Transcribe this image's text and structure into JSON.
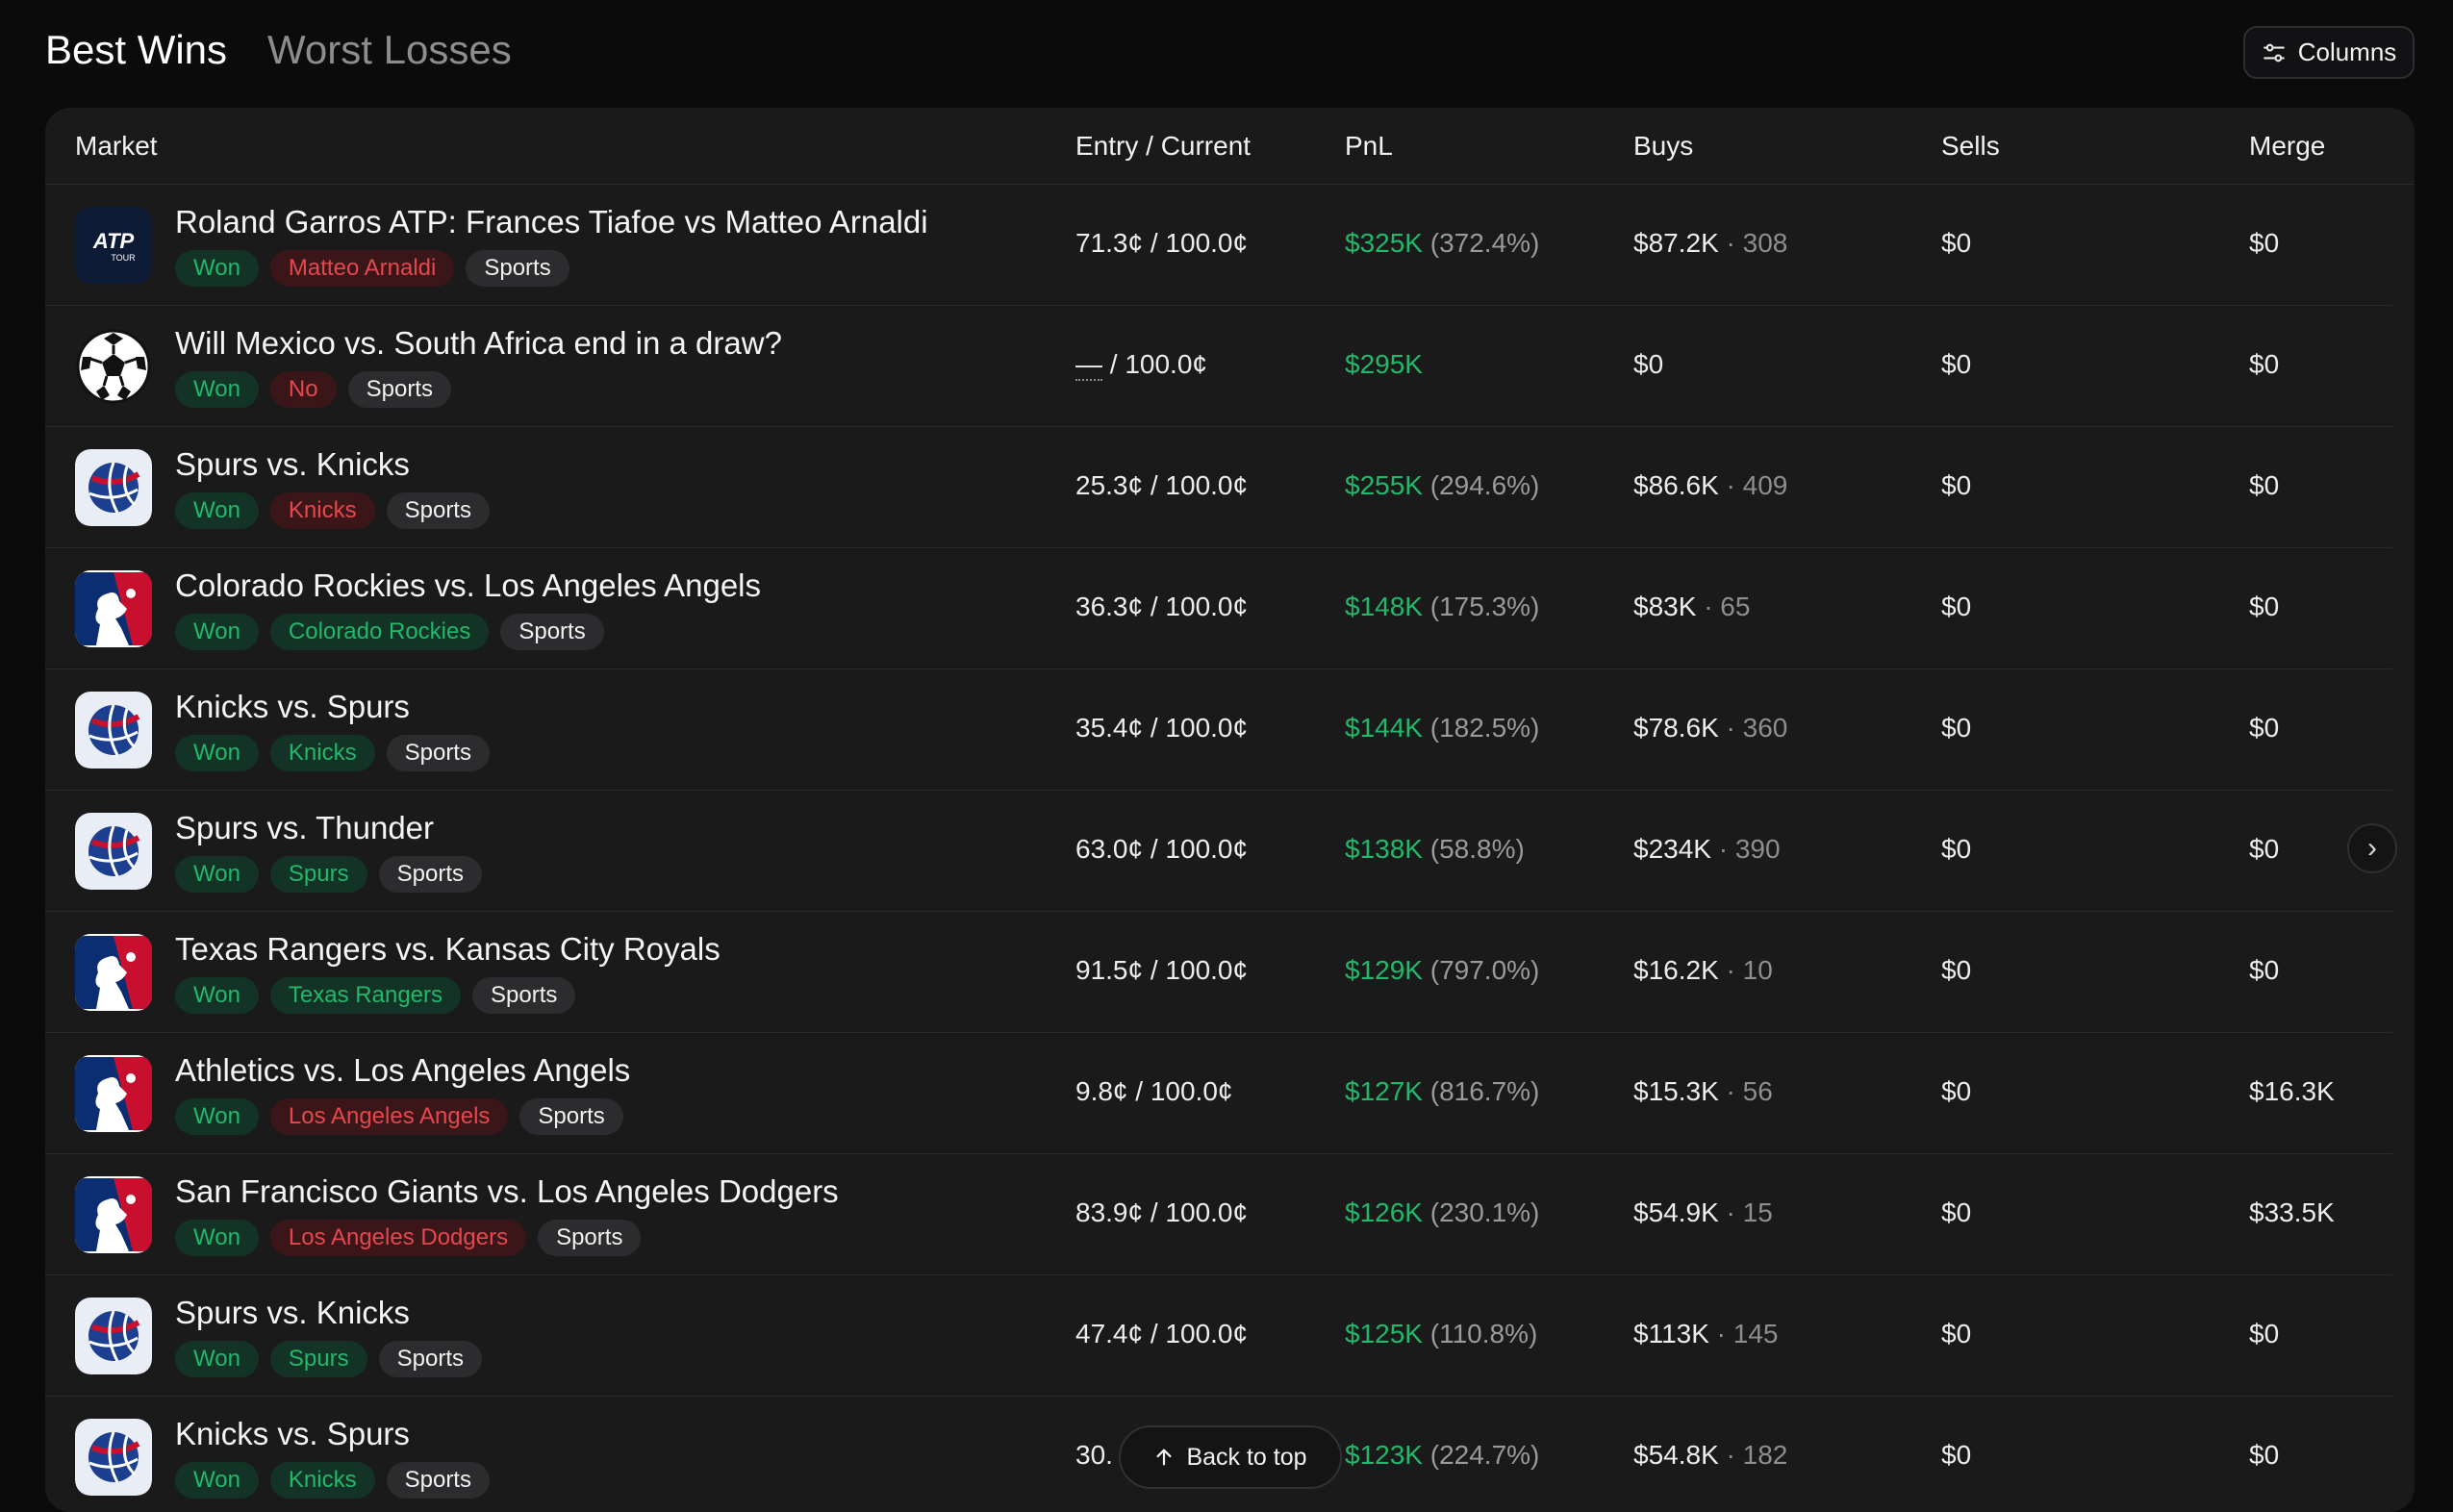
{
  "tabs": [
    {
      "label": "Best Wins",
      "active": true
    },
    {
      "label": "Worst Losses",
      "active": false
    }
  ],
  "columns_button": {
    "label": "Columns",
    "icon": "sliders-icon"
  },
  "headers": {
    "market": "Market",
    "entry": "Entry / Current",
    "pnl": "PnL",
    "buys": "Buys",
    "sells": "Sells",
    "merge": "Merge"
  },
  "rows": [
    {
      "logo": "atp-tour",
      "title": "Roland Garros ATP: Frances Tiafoe vs Matteo Arnaldi",
      "status": "Won",
      "outcome": "Matteo Arnaldi",
      "outcome_color": "red",
      "category": "Sports",
      "entry": "71.3¢",
      "current": "100.0¢",
      "pnl": "$325K",
      "pnl_pct": "(372.4%)",
      "buys": "$87.2K",
      "buys_count": "· 308",
      "sells": "$0",
      "merge": "$0"
    },
    {
      "logo": "soccer-ball",
      "title": "Will Mexico vs. South Africa end in a draw?",
      "status": "Won",
      "outcome": "No",
      "outcome_color": "red",
      "category": "Sports",
      "entry": "—",
      "current": "100.0¢",
      "pnl": "$295K",
      "pnl_pct": "",
      "buys": "$0",
      "buys_count": "",
      "sells": "$0",
      "merge": "$0"
    },
    {
      "logo": "nba-ball",
      "title": "Spurs vs. Knicks",
      "status": "Won",
      "outcome": "Knicks",
      "outcome_color": "red",
      "category": "Sports",
      "entry": "25.3¢",
      "current": "100.0¢",
      "pnl": "$255K",
      "pnl_pct": "(294.6%)",
      "buys": "$86.6K",
      "buys_count": "· 409",
      "sells": "$0",
      "merge": "$0"
    },
    {
      "logo": "mlb",
      "title": "Colorado Rockies vs. Los Angeles Angels",
      "status": "Won",
      "outcome": "Colorado Rockies",
      "outcome_color": "green",
      "category": "Sports",
      "entry": "36.3¢",
      "current": "100.0¢",
      "pnl": "$148K",
      "pnl_pct": "(175.3%)",
      "buys": "$83K",
      "buys_count": "· 65",
      "sells": "$0",
      "merge": "$0"
    },
    {
      "logo": "nba-ball",
      "title": "Knicks vs. Spurs",
      "status": "Won",
      "outcome": "Knicks",
      "outcome_color": "green",
      "category": "Sports",
      "entry": "35.4¢",
      "current": "100.0¢",
      "pnl": "$144K",
      "pnl_pct": "(182.5%)",
      "buys": "$78.6K",
      "buys_count": "· 360",
      "sells": "$0",
      "merge": "$0"
    },
    {
      "logo": "nba-ball",
      "title": "Spurs vs. Thunder",
      "status": "Won",
      "outcome": "Spurs",
      "outcome_color": "green",
      "category": "Sports",
      "entry": "63.0¢",
      "current": "100.0¢",
      "pnl": "$138K",
      "pnl_pct": "(58.8%)",
      "buys": "$234K",
      "buys_count": "· 390",
      "sells": "$0",
      "merge": "$0"
    },
    {
      "logo": "mlb",
      "title": "Texas Rangers vs. Kansas City Royals",
      "status": "Won",
      "outcome": "Texas Rangers",
      "outcome_color": "green",
      "category": "Sports",
      "entry": "91.5¢",
      "current": "100.0¢",
      "pnl": "$129K",
      "pnl_pct": "(797.0%)",
      "buys": "$16.2K",
      "buys_count": "· 10",
      "sells": "$0",
      "merge": "$0"
    },
    {
      "logo": "mlb",
      "title": "Athletics vs. Los Angeles Angels",
      "status": "Won",
      "outcome": "Los Angeles Angels",
      "outcome_color": "red",
      "category": "Sports",
      "entry": "9.8¢",
      "current": "100.0¢",
      "pnl": "$127K",
      "pnl_pct": "(816.7%)",
      "buys": "$15.3K",
      "buys_count": "· 56",
      "sells": "$0",
      "merge": "$16.3K"
    },
    {
      "logo": "mlb",
      "title": "San Francisco Giants vs. Los Angeles Dodgers",
      "status": "Won",
      "outcome": "Los Angeles Dodgers",
      "outcome_color": "red",
      "category": "Sports",
      "entry": "83.9¢",
      "current": "100.0¢",
      "pnl": "$126K",
      "pnl_pct": "(230.1%)",
      "buys": "$54.9K",
      "buys_count": "· 15",
      "sells": "$0",
      "merge": "$33.5K"
    },
    {
      "logo": "nba-ball",
      "title": "Spurs vs. Knicks",
      "status": "Won",
      "outcome": "Spurs",
      "outcome_color": "green",
      "category": "Sports",
      "entry": "47.4¢",
      "current": "100.0¢",
      "pnl": "$125K",
      "pnl_pct": "(110.8%)",
      "buys": "$113K",
      "buys_count": "· 145",
      "sells": "$0",
      "merge": "$0"
    },
    {
      "logo": "nba-ball",
      "title": "Knicks vs. Spurs",
      "status": "Won",
      "outcome": "Knicks",
      "outcome_color": "green",
      "category": "Sports",
      "entry": "30.",
      "current": "100.0¢",
      "pnl": "$123K",
      "pnl_pct": "(224.7%)",
      "buys": "$54.8K",
      "buys_count": "· 182",
      "sells": "$0",
      "merge": "$0"
    }
  ],
  "scroll_button": {
    "icon": "chevron-right-icon"
  },
  "back_to_top": {
    "label": "Back to top",
    "icon": "arrow-up-icon"
  }
}
